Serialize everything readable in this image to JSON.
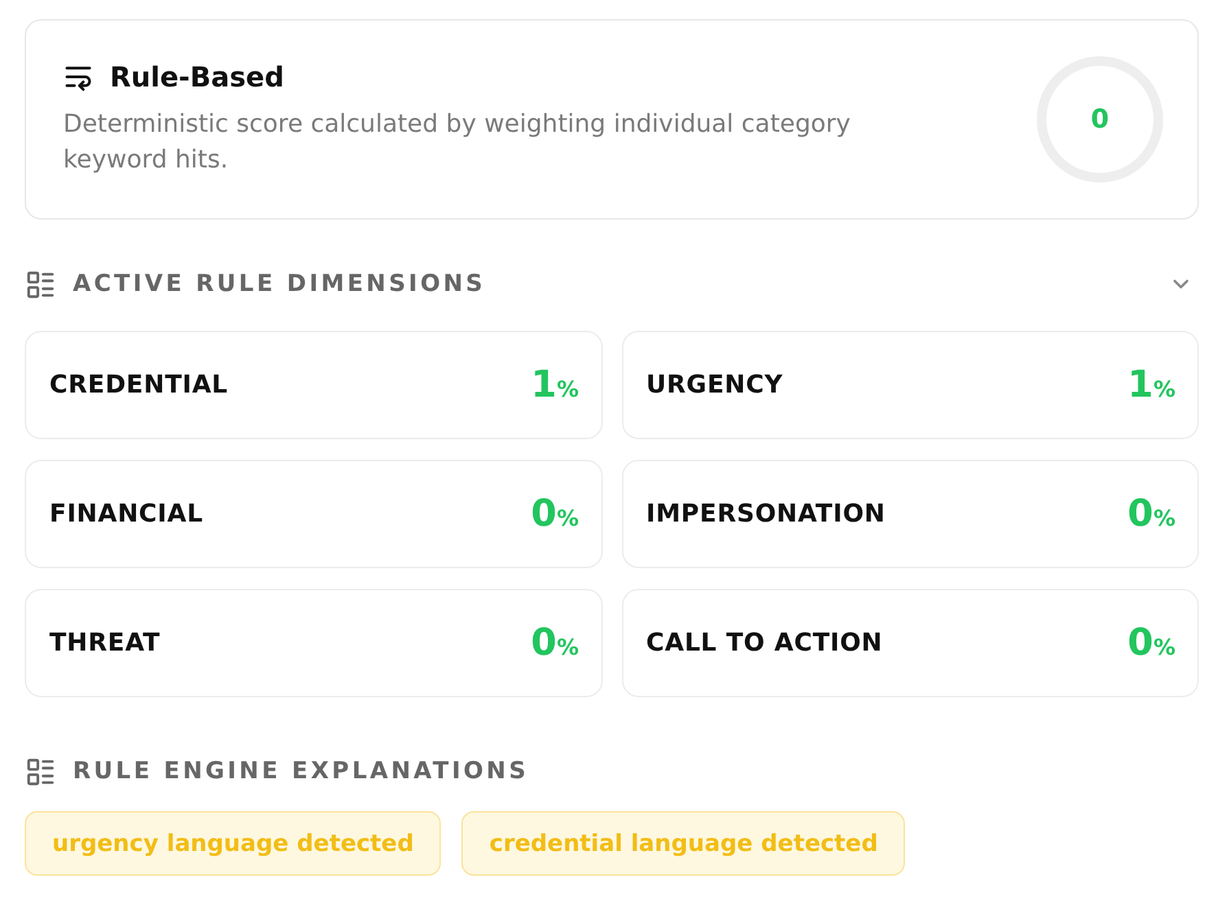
{
  "summary": {
    "title": "Rule-Based",
    "description": "Deterministic score calculated by weighting individual category keyword hits.",
    "score": "0"
  },
  "dimensions": {
    "title": "ACTIVE RULE DIMENSIONS",
    "items": [
      {
        "label": "CREDENTIAL",
        "value": "1",
        "unit": "%"
      },
      {
        "label": "URGENCY",
        "value": "1",
        "unit": "%"
      },
      {
        "label": "FINANCIAL",
        "value": "0",
        "unit": "%"
      },
      {
        "label": "IMPERSONATION",
        "value": "0",
        "unit": "%"
      },
      {
        "label": "THREAT",
        "value": "0",
        "unit": "%"
      },
      {
        "label": "CALL TO ACTION",
        "value": "0",
        "unit": "%"
      }
    ]
  },
  "explanations": {
    "title": "RULE ENGINE EXPLANATIONS",
    "tags": [
      "urgency language detected",
      "credential language detected"
    ]
  }
}
